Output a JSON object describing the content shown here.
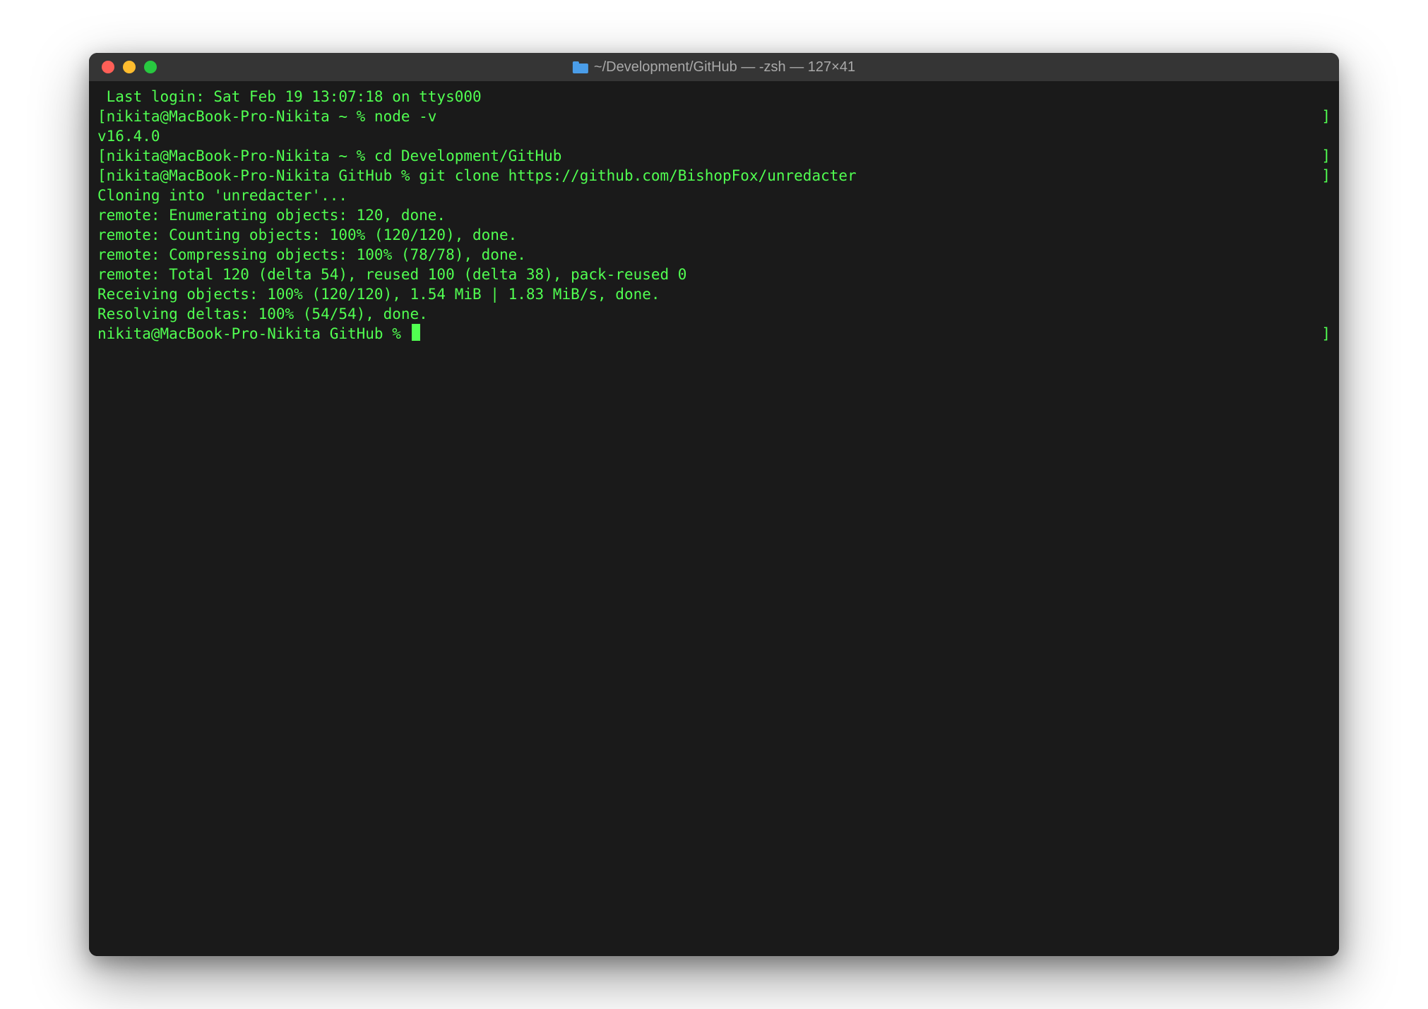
{
  "titlebar": {
    "title": "~/Development/GitHub — -zsh — 127×41"
  },
  "terminal": {
    "lines": {
      "l0": " Last login: Sat Feb 19 13:07:18 on ttys000",
      "l1_prompt": "[nikita@MacBook-Pro-Nikita ~ % node -v",
      "l1_close": "]",
      "l2": "v16.4.0",
      "l3_prompt": "[nikita@MacBook-Pro-Nikita ~ % cd Development/GitHub",
      "l3_close": "]",
      "l4_prompt": "[nikita@MacBook-Pro-Nikita GitHub % git clone https://github.com/BishopFox/unredacter",
      "l4_close": "]",
      "l5": "Cloning into 'unredacter'...",
      "l6": "remote: Enumerating objects: 120, done.",
      "l7": "remote: Counting objects: 100% (120/120), done.",
      "l8": "remote: Compressing objects: 100% (78/78), done.",
      "l9": "remote: Total 120 (delta 54), reused 100 (delta 38), pack-reused 0",
      "l10": "Receiving objects: 100% (120/120), 1.54 MiB | 1.83 MiB/s, done.",
      "l11": "Resolving deltas: 100% (54/54), done.",
      "l12_prompt": "nikita@MacBook-Pro-Nikita GitHub % ",
      "l12_close": "]"
    }
  }
}
